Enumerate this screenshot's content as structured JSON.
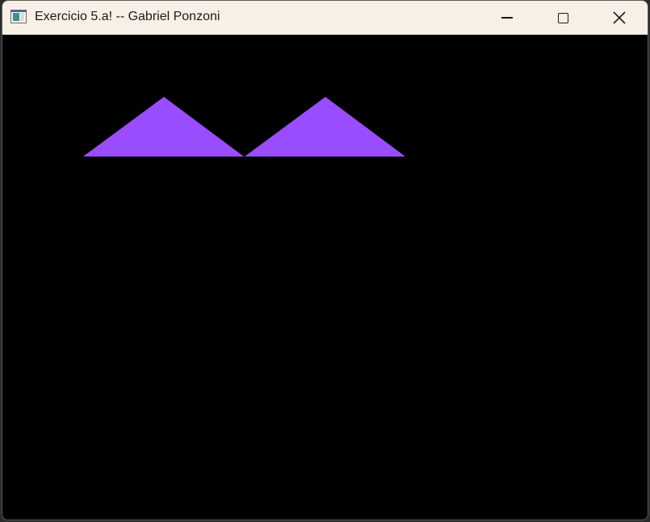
{
  "window": {
    "title": "Exercicio 5.a! -- Gabriel Ponzoni",
    "app_icon": "opengl-window-icon",
    "controls": {
      "minimize_icon": "minimize-icon",
      "maximize_icon": "maximize-icon",
      "close_icon": "close-icon"
    }
  },
  "canvas": {
    "background_color": "#000000",
    "shape_color": "#9a4dff",
    "shapes": [
      {
        "type": "triangle"
      },
      {
        "type": "triangle"
      }
    ]
  }
}
